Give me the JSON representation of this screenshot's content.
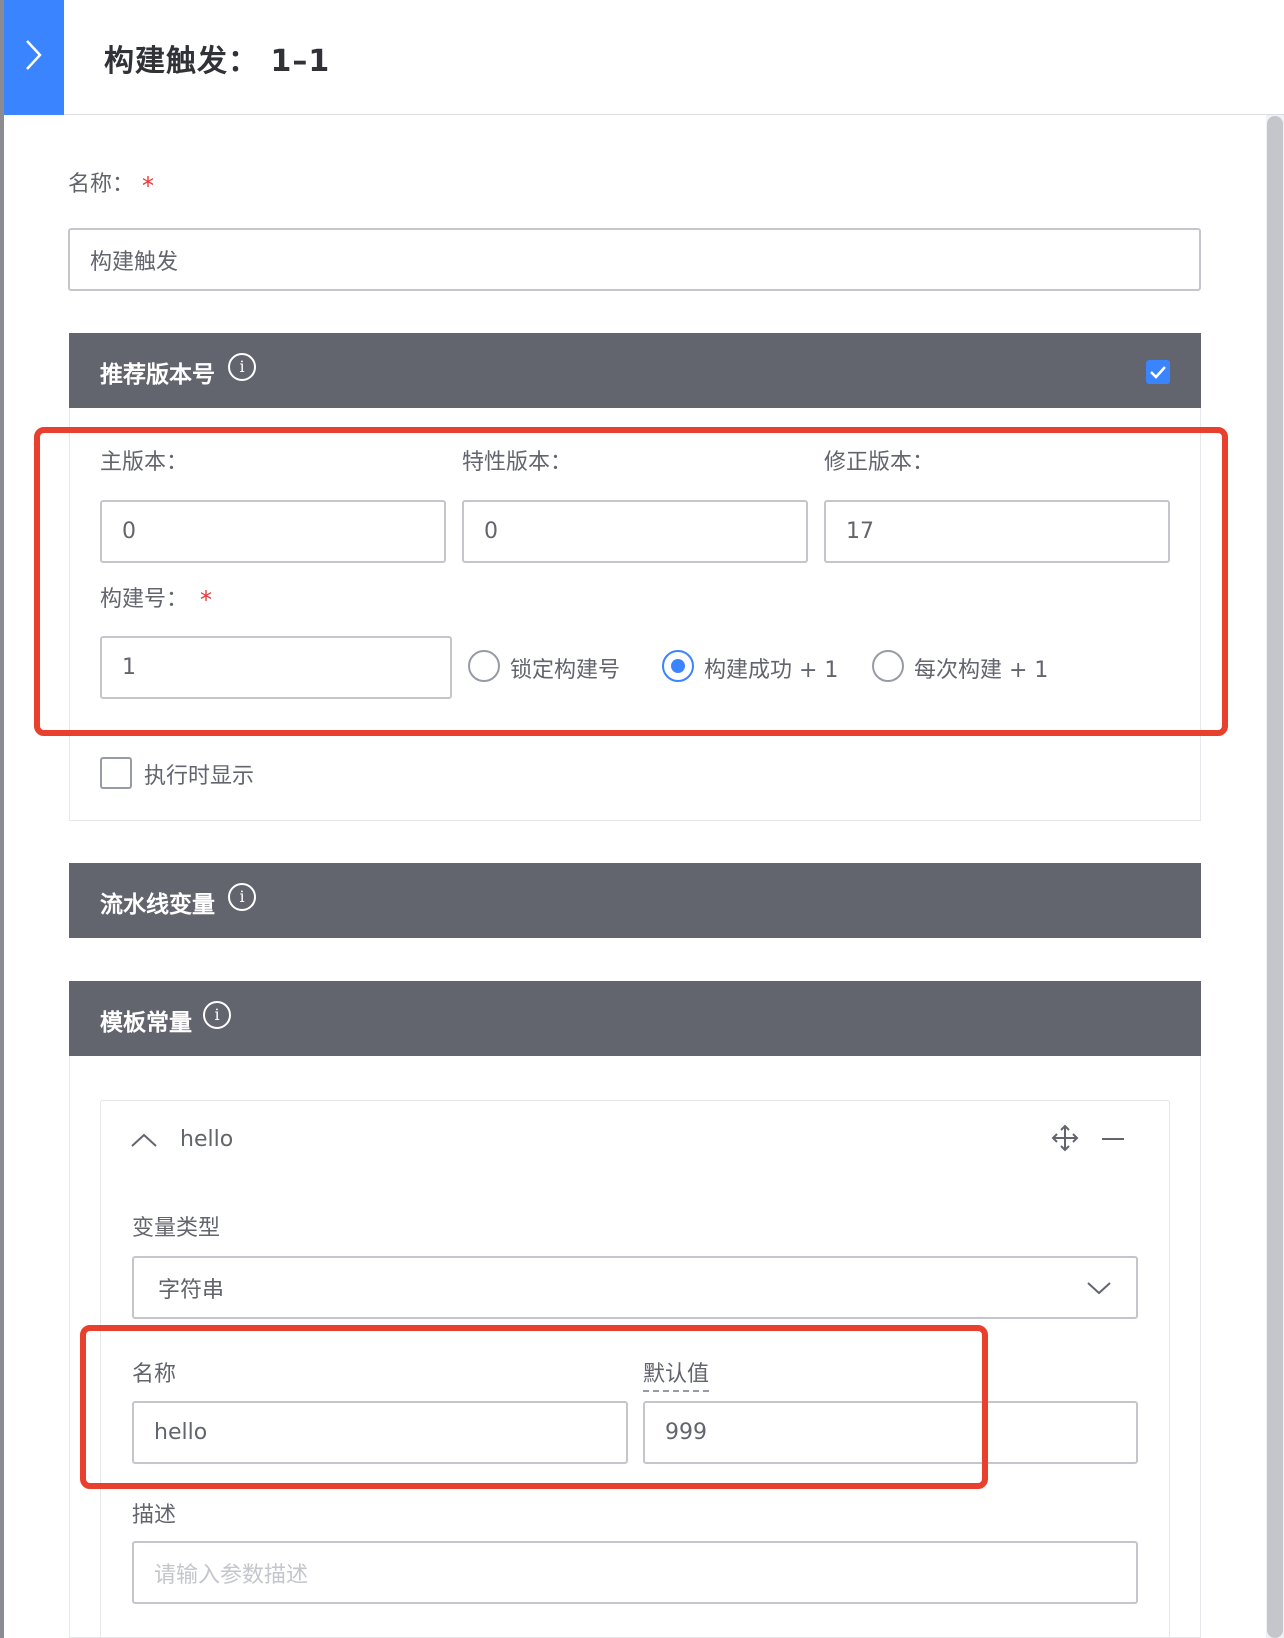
{
  "header": {
    "title": "构建触发： 1–1"
  },
  "form": {
    "name_label": "名称：",
    "name_value": "构建触发"
  },
  "version_section": {
    "title": "推荐版本号",
    "enabled": true,
    "major_label": "主版本：",
    "major_value": "0",
    "feature_label": "特性版本：",
    "feature_value": "0",
    "fix_label": "修正版本：",
    "fix_value": "17",
    "build_label": "构建号：",
    "build_value": "1",
    "strategies": [
      {
        "label": "锁定构建号",
        "checked": false
      },
      {
        "label": "构建成功 + 1",
        "checked": true
      },
      {
        "label": "每次构建 + 1",
        "checked": false
      }
    ],
    "show_on_exec_label": "执行时显示",
    "show_on_exec_checked": false
  },
  "pipeline_vars": {
    "title": "流水线变量"
  },
  "template_consts": {
    "title": "模板常量",
    "item": {
      "name": "hello",
      "type_label": "变量类型",
      "type_value": "字符串",
      "name_label": "名称",
      "name_value": "hello",
      "default_label": "默认值",
      "default_value": "999",
      "desc_label": "描述",
      "desc_placeholder": "请输入参数描述"
    }
  },
  "colors": {
    "primary": "#3a84ff",
    "section_header": "#63656e",
    "required": "#ea3636",
    "annotation": "#e8402c"
  }
}
